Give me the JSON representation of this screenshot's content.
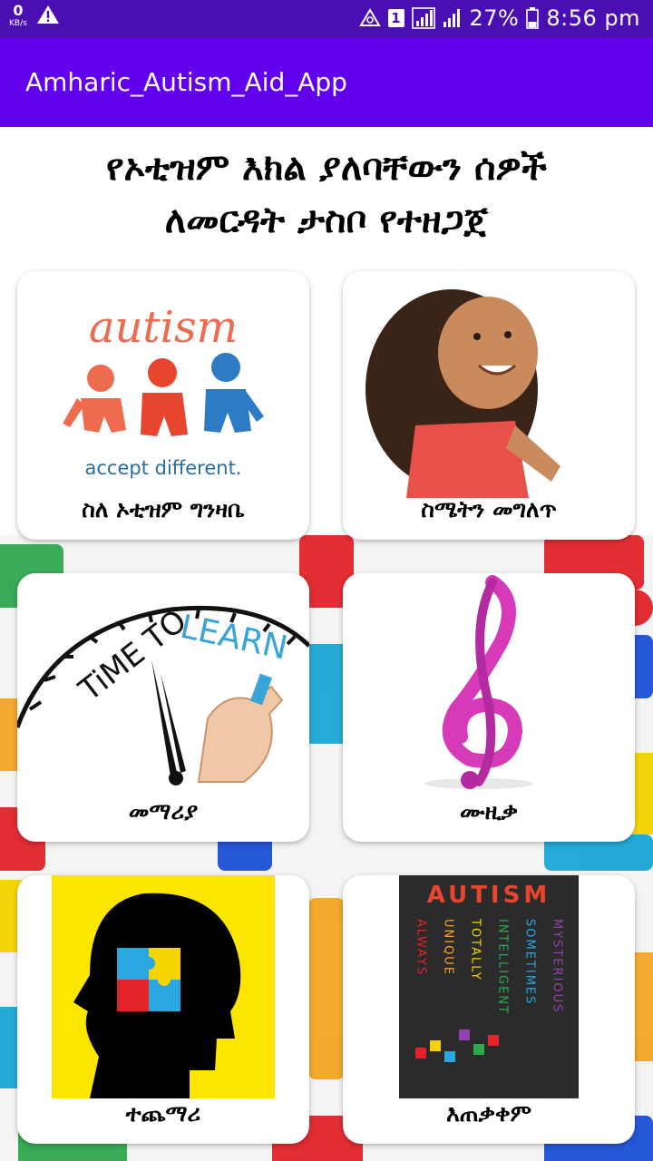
{
  "status_bar": {
    "speed_value": "0",
    "speed_unit": "KB/s",
    "sim_slot": "1",
    "battery": "27%",
    "time": "8:56 pm"
  },
  "app_bar": {
    "title": "Amharic_Autism_Aid_App"
  },
  "heading": {
    "line1": "የኦቲዝም እክል ያለባቸውን ሰዎች",
    "line2": "ለመርዳት ታስቦ የተዘጋጀ"
  },
  "cards": [
    {
      "label": "ስለ ኦቲዝም ግንዛቤ",
      "image_word": "autism",
      "image_caption": "accept different."
    },
    {
      "label": "ስሜትን መግለጥ"
    },
    {
      "label": "መማሪያ",
      "image_text1": "TiME TO",
      "image_text2": "LEARN"
    },
    {
      "label": "ሙዚቃ"
    },
    {
      "label": "ተጨማሪ"
    },
    {
      "label": "እጠቃቀም",
      "image_title": "AUTISM",
      "image_words": [
        "ALWAYS",
        "UNIQUE",
        "TOTALLY",
        "INTELLIGENT",
        "SOMETIMES",
        "MYSTERIOUS"
      ]
    }
  ]
}
